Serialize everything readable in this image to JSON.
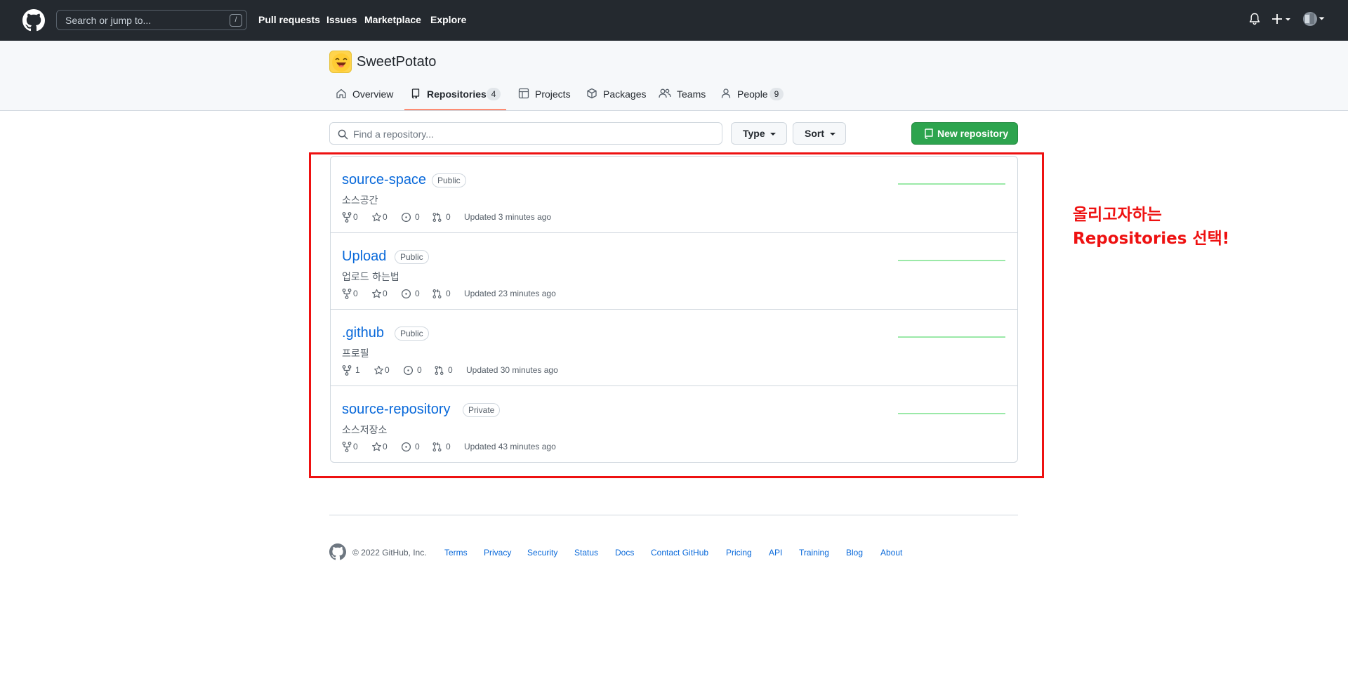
{
  "header": {
    "search_placeholder": "Search or jump to...",
    "search_shortcut": "/",
    "nav": [
      "Pull requests",
      "Issues",
      "Marketplace",
      "Explore"
    ]
  },
  "org": {
    "name": "SweetPotato",
    "tabs": [
      {
        "label": "Overview",
        "count": null,
        "icon": "home-icon",
        "active": false
      },
      {
        "label": "Repositories",
        "count": "4",
        "icon": "repo-icon",
        "active": true
      },
      {
        "label": "Projects",
        "count": null,
        "icon": "table-icon",
        "active": false
      },
      {
        "label": "Packages",
        "count": null,
        "icon": "package-icon",
        "active": false
      },
      {
        "label": "Teams",
        "count": null,
        "icon": "people-icon",
        "active": false
      },
      {
        "label": "People",
        "count": "9",
        "icon": "person-icon",
        "active": false
      }
    ]
  },
  "controls": {
    "find_placeholder": "Find a repository...",
    "type_label": "Type",
    "sort_label": "Sort",
    "new_repo_label": "New repository"
  },
  "repos": [
    {
      "name": "source-space",
      "visibility": "Public",
      "description": "소스공간",
      "forks": "0",
      "stars": "0",
      "issues": "0",
      "pulls": "0",
      "updated": "Updated 3 minutes ago"
    },
    {
      "name": "Upload",
      "visibility": "Public",
      "description": "업로드 하는법",
      "forks": "0",
      "stars": "0",
      "issues": "0",
      "pulls": "0",
      "updated": "Updated 23 minutes ago"
    },
    {
      "name": ".github",
      "visibility": "Public",
      "description": "프로필",
      "forks": "1",
      "stars": "0",
      "issues": "0",
      "pulls": "0",
      "updated": "Updated 30 minutes ago"
    },
    {
      "name": "source-repository",
      "visibility": "Private",
      "description": "소스저장소",
      "forks": "0",
      "stars": "0",
      "issues": "0",
      "pulls": "0",
      "updated": "Updated 43 minutes ago"
    }
  ],
  "annotation": {
    "line1": "올리고자하는",
    "line2": "Repositories 선택!",
    "color": "#ee1111"
  },
  "footer": {
    "copyright": "© 2022 GitHub, Inc.",
    "links": [
      "Terms",
      "Privacy",
      "Security",
      "Status",
      "Docs",
      "Contact GitHub",
      "Pricing",
      "API",
      "Training",
      "Blog",
      "About"
    ]
  },
  "colors": {
    "header_bg": "#24292f",
    "link": "#0969da",
    "primary_button": "#2da44e",
    "tab_underline": "#fd8c73",
    "sparkline": "#9be9a8"
  }
}
